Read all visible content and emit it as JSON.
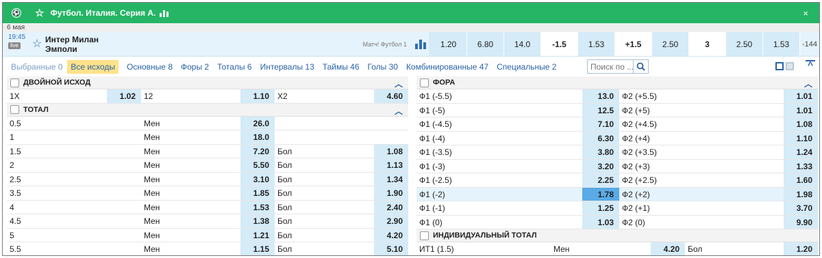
{
  "league": {
    "title": "Футбол. Италия. Серия А.",
    "close": "×"
  },
  "date": "6 мая",
  "event": {
    "time": "19:45",
    "live_badge": "live",
    "team1": "Интер Милан",
    "team2": "Эмполи",
    "match_label": "Матч! Футбол 1",
    "odds": [
      {
        "v": "1.20",
        "w": false
      },
      {
        "v": "6.80",
        "w": false
      },
      {
        "v": "14.0",
        "w": false
      },
      {
        "v": "-1.5",
        "w": true
      },
      {
        "v": "1.53",
        "w": false
      },
      {
        "v": "+1.5",
        "w": true
      },
      {
        "v": "2.50",
        "w": false
      },
      {
        "v": "3",
        "w": true
      },
      {
        "v": "2.50",
        "w": false
      },
      {
        "v": "1.53",
        "w": false
      }
    ],
    "more": "-144"
  },
  "filters": [
    {
      "label": "Выбранные 0",
      "state": "dim"
    },
    {
      "label": "Все исходы",
      "state": "act"
    },
    {
      "label": "Основные 8",
      "state": ""
    },
    {
      "label": "Форы 2",
      "state": ""
    },
    {
      "label": "Тоталы 6",
      "state": ""
    },
    {
      "label": "Интервалы 13",
      "state": ""
    },
    {
      "label": "Таймы 46",
      "state": ""
    },
    {
      "label": "Голы 30",
      "state": ""
    },
    {
      "label": "Комбинированные 47",
      "state": ""
    },
    {
      "label": "Специальные 2",
      "state": ""
    }
  ],
  "search": {
    "placeholder": "Поиск по ..."
  },
  "double_chance": {
    "title": "ДВОЙНОЙ ИСХОД",
    "cells": [
      {
        "label": "1X",
        "odd": "1.02"
      },
      {
        "label": "12",
        "odd": "1.10"
      },
      {
        "label": "X2",
        "odd": "4.60"
      }
    ]
  },
  "total": {
    "title": "ТОТАЛ",
    "under_label": "Мен",
    "over_label": "Бол",
    "rows": [
      {
        "line": "0.5",
        "under": "26.0",
        "over": ""
      },
      {
        "line": "1",
        "under": "18.0",
        "over": ""
      },
      {
        "line": "1.5",
        "under": "7.20",
        "over": "1.08"
      },
      {
        "line": "2",
        "under": "5.50",
        "over": "1.13"
      },
      {
        "line": "2.5",
        "under": "3.10",
        "over": "1.34"
      },
      {
        "line": "3.5",
        "under": "1.85",
        "over": "1.90"
      },
      {
        "line": "4",
        "under": "1.53",
        "over": "2.40"
      },
      {
        "line": "4.5",
        "under": "1.38",
        "over": "2.90"
      },
      {
        "line": "5",
        "under": "1.21",
        "over": "4.20"
      },
      {
        "line": "5.5",
        "under": "1.15",
        "over": "5.10"
      }
    ]
  },
  "handicap": {
    "title": "ФОРА",
    "rows": [
      {
        "h1": "Ф1 (-5.5)",
        "o1": "13.0",
        "h2": "Ф2 (+5.5)",
        "o2": "1.01",
        "sel": false
      },
      {
        "h1": "Ф1 (-5)",
        "o1": "12.5",
        "h2": "Ф2 (+5)",
        "o2": "1.01",
        "sel": false
      },
      {
        "h1": "Ф1 (-4.5)",
        "o1": "7.10",
        "h2": "Ф2 (+4.5)",
        "o2": "1.08",
        "sel": false
      },
      {
        "h1": "Ф1 (-4)",
        "o1": "6.30",
        "h2": "Ф2 (+4)",
        "o2": "1.10",
        "sel": false
      },
      {
        "h1": "Ф1 (-3.5)",
        "o1": "3.80",
        "h2": "Ф2 (+3.5)",
        "o2": "1.24",
        "sel": false
      },
      {
        "h1": "Ф1 (-3)",
        "o1": "3.20",
        "h2": "Ф2 (+3)",
        "o2": "1.33",
        "sel": false
      },
      {
        "h1": "Ф1 (-2.5)",
        "o1": "2.25",
        "h2": "Ф2 (+2.5)",
        "o2": "1.60",
        "sel": false
      },
      {
        "h1": "Ф1 (-2)",
        "o1": "1.78",
        "h2": "Ф2 (+2)",
        "o2": "1.98",
        "sel": true
      },
      {
        "h1": "Ф1 (-1)",
        "o1": "1.25",
        "h2": "Ф2 (+1)",
        "o2": "3.70",
        "sel": false
      },
      {
        "h1": "Ф1 (0)",
        "o1": "1.03",
        "h2": "Ф2 (0)",
        "o2": "9.90",
        "sel": false
      }
    ]
  },
  "ind_total": {
    "title": "ИНДИВИДУАЛЬНЫЙ ТОТАЛ",
    "rows": [
      {
        "label": "ИТ1 (1.5)",
        "under_label": "Мен",
        "under": "4.20",
        "over_label": "Бол",
        "over": "1.20"
      }
    ]
  },
  "colors": {
    "header_green": "#25b565",
    "odd_bg": "#d5ebf8",
    "selected": "#5aaae6",
    "link": "#2a63a8"
  }
}
